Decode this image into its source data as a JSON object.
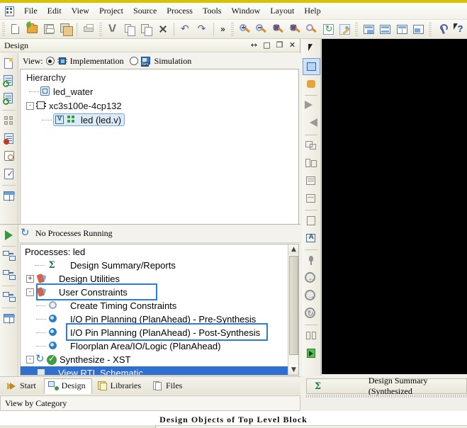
{
  "app": {
    "icon": "xilinx-ise-icon"
  },
  "menubar": {
    "items": [
      {
        "label": "File",
        "mnemonic": "F"
      },
      {
        "label": "Edit",
        "mnemonic": "E"
      },
      {
        "label": "View",
        "mnemonic": "V"
      },
      {
        "label": "Project",
        "mnemonic": "j"
      },
      {
        "label": "Source",
        "mnemonic": "S"
      },
      {
        "label": "Process",
        "mnemonic": "P"
      },
      {
        "label": "Tools",
        "mnemonic": "T"
      },
      {
        "label": "Window",
        "mnemonic": "W"
      },
      {
        "label": "Layout",
        "mnemonic": "y"
      },
      {
        "label": "Help",
        "mnemonic": "H"
      }
    ]
  },
  "toolbar": {
    "buttons": [
      {
        "name": "new-file-icon"
      },
      {
        "name": "open-project-icon"
      },
      {
        "name": "save-icon"
      },
      {
        "name": "save-all-icon"
      },
      {
        "name": "print-icon"
      },
      {
        "name": "cut-icon"
      },
      {
        "name": "copy-icon"
      },
      {
        "name": "paste-icon"
      },
      {
        "name": "delete-icon"
      },
      {
        "name": "undo-icon"
      },
      {
        "name": "redo-icon"
      }
    ],
    "overflow_label": "»",
    "zoom_buttons": [
      {
        "name": "zoom-in-icon"
      },
      {
        "name": "zoom-out-icon"
      },
      {
        "name": "zoom-fit-icon"
      },
      {
        "name": "zoom-selection-icon"
      },
      {
        "name": "zoom-area-icon"
      },
      {
        "name": "refresh-icon"
      },
      {
        "name": "highlight-icon"
      }
    ],
    "panel_buttons": [
      {
        "name": "panel-layout-1-icon"
      },
      {
        "name": "panel-layout-2-icon"
      },
      {
        "name": "panel-layout-3-icon"
      },
      {
        "name": "panel-layout-4-icon"
      }
    ],
    "right_buttons": [
      {
        "name": "options-wrench-icon"
      },
      {
        "name": "context-help-icon"
      }
    ]
  },
  "design_panel": {
    "title": "Design",
    "title_buttons": [
      {
        "name": "float-icon",
        "glyph": "↔"
      },
      {
        "name": "maximize-icon",
        "glyph": "□"
      },
      {
        "name": "restore-icon",
        "glyph": "❐"
      },
      {
        "name": "close-icon",
        "glyph": "✕"
      }
    ],
    "view_bar": {
      "label": "View:",
      "options": [
        {
          "label": "Implementation",
          "selected": true,
          "icon": "chip-icon"
        },
        {
          "label": "Simulation",
          "selected": false,
          "icon": "simulation-icon"
        }
      ]
    },
    "hierarchy": {
      "header": "Hierarchy",
      "nodes": [
        {
          "label": "led_water",
          "icon": "project-module-icon",
          "indent": 1,
          "expander": "",
          "selected": false
        },
        {
          "label": "xc3s100e-4cp132",
          "icon": "fpga-device-icon",
          "indent": 0,
          "expander": "-",
          "selected": false
        },
        {
          "label": "led (led.v)",
          "icon": "verilog-module-icon",
          "indent": 2,
          "expander": "",
          "selected": true
        }
      ]
    },
    "rail_icons": [
      "new-source-icon",
      "add-source-icon",
      "add-copy-source-icon",
      "view-design-summary-icon",
      "design-goals-icon",
      "create-timing-constraints-icon",
      "check-syntax-icon",
      "design-table-icon"
    ]
  },
  "process_panel": {
    "status_text": "No Processes Running",
    "status_icon": "processes-sync-icon",
    "header": "Processes: led",
    "rail_icons": [
      "run-icon",
      "implement-top-module-icon",
      "process-properties-icon",
      "rerun-all-icon",
      "design-summary-table-icon"
    ],
    "rows": [
      {
        "label": "Design Summary/Reports",
        "icon": "sigma-reports-icon",
        "indent": 1,
        "expander": "",
        "selected": false
      },
      {
        "label": "Design Utilities",
        "icon": "design-utilities-icon",
        "indent": 0,
        "expander": "+",
        "selected": false
      },
      {
        "label": "User Constraints",
        "icon": "user-constraints-icon",
        "indent": 0,
        "expander": "-",
        "selected": false
      },
      {
        "label": "Create Timing Constraints",
        "icon": "create-timing-constraints-icon",
        "indent": 2,
        "expander": "",
        "selected": false
      },
      {
        "label": "I/O Pin Planning (PlanAhead) - Pre-Synthesis",
        "icon": "io-pin-planning-icon",
        "indent": 2,
        "expander": "",
        "selected": false
      },
      {
        "label": "I/O Pin Planning (PlanAhead) - Post-Synthesis",
        "icon": "io-pin-planning-icon",
        "indent": 2,
        "expander": "",
        "selected": false
      },
      {
        "label": "Floorplan Area/IO/Logic (PlanAhead)",
        "icon": "floorplan-icon",
        "indent": 2,
        "expander": "",
        "selected": false
      },
      {
        "label": "Synthesize - XST",
        "icon": "synthesize-ok-icon",
        "indent": 0,
        "expander": "-",
        "selected": false
      },
      {
        "label": "View RTL Schematic",
        "icon": "rtl-schematic-icon",
        "indent": 2,
        "expander": "",
        "selected": true
      }
    ],
    "scroll": {
      "up_glyph": "▲",
      "down_glyph": "▼"
    }
  },
  "annotations": [
    {
      "name": "annotation-user-constraints",
      "color": "#2a7fd4"
    },
    {
      "name": "annotation-io-pin-planning-post-synthesis",
      "color": "#2a7fd4"
    }
  ],
  "right_toolbar": {
    "icons": [
      "select-pointer-icon",
      "schematic-net-icon",
      "explode-icon",
      "step-forward-icon",
      "step-back-icon",
      "new-sheet-icon",
      "split-sheet-icon",
      "list-view-icon",
      "report-view-icon",
      "properties-icon",
      "add-text-icon",
      "pin-icon",
      "back-navigate-icon",
      "forward-navigate-icon",
      "refresh-view-icon",
      "compare-panes-icon",
      "open-schematic-icon"
    ]
  },
  "bottom_tabs": {
    "tabs": [
      {
        "label": "Start",
        "icon": "start-arrow-icon",
        "active": false
      },
      {
        "label": "Design",
        "icon": "design-panel-icon",
        "active": true
      },
      {
        "label": "Libraries",
        "icon": "libraries-icon",
        "active": false
      },
      {
        "label": "Files",
        "icon": "files-icon",
        "active": false
      }
    ]
  },
  "right_bottom_tab": {
    "label": "Design Summary (Synthesized",
    "icon": "sigma-reports-icon"
  },
  "status": {
    "left_text": "View by Category",
    "center_text": "Design Objects of Top Level Block"
  }
}
